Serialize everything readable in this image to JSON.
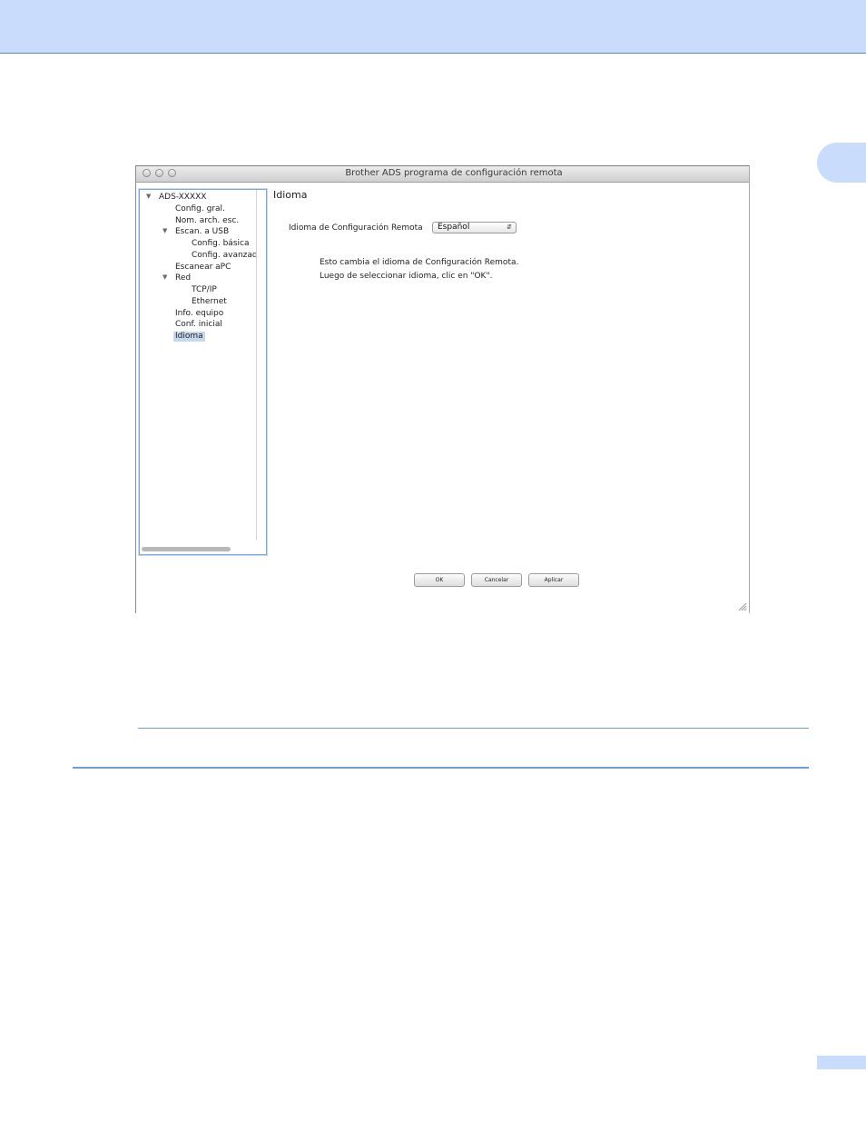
{
  "window": {
    "title": "Brother ADS programa de configuración remota"
  },
  "sidebar": {
    "items": [
      {
        "label": "ADS-XXXXX",
        "expanded": true
      },
      {
        "label": "Config. gral."
      },
      {
        "label": "Nom. arch. esc."
      },
      {
        "label": "Escan. a USB",
        "expanded": true
      },
      {
        "label": "Config. básica"
      },
      {
        "label": "Config. avanzad"
      },
      {
        "label": "Escanear aPC"
      },
      {
        "label": "Red",
        "expanded": true
      },
      {
        "label": "TCP/IP"
      },
      {
        "label": "Ethernet"
      },
      {
        "label": "Info. equipo"
      },
      {
        "label": "Conf. inicial"
      },
      {
        "label": "Idioma",
        "selected": true
      }
    ]
  },
  "main": {
    "title": "Idioma",
    "language_label": "Idioma de Configuración Remota",
    "language_value": "Español",
    "info_line1": "Esto cambia el idioma de Configuración Remota.",
    "info_line2": "Luego de seleccionar idioma, clic en \"OK\"."
  },
  "buttons": {
    "ok": "OK",
    "cancel": "Cancelar",
    "apply": "Aplicar"
  },
  "colors": {
    "header_band": "#c9dcfb",
    "rule": "#6e9be0",
    "selection": "#c7d7ee"
  }
}
